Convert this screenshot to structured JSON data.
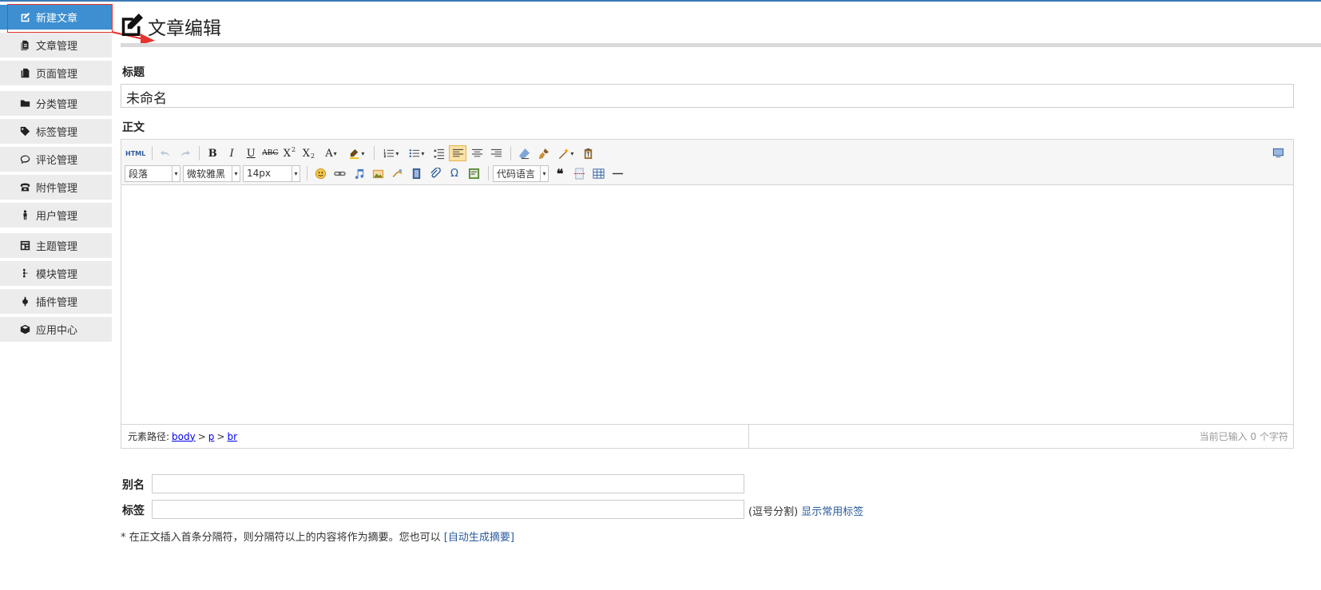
{
  "sidebar": {
    "items": [
      {
        "label": "新建文章",
        "icon": "edit-icon"
      },
      {
        "label": "文章管理",
        "icon": "document-icon"
      },
      {
        "label": "页面管理",
        "icon": "pages-icon"
      },
      {
        "label": "分类管理",
        "icon": "folder-icon"
      },
      {
        "label": "标签管理",
        "icon": "tag-icon"
      },
      {
        "label": "评论管理",
        "icon": "comment-icon"
      },
      {
        "label": "附件管理",
        "icon": "attachment-icon"
      },
      {
        "label": "用户管理",
        "icon": "user-icon"
      },
      {
        "label": "主题管理",
        "icon": "theme-icon"
      },
      {
        "label": "模块管理",
        "icon": "module-icon"
      },
      {
        "label": "插件管理",
        "icon": "plugin-icon"
      },
      {
        "label": "应用中心",
        "icon": "app-center-icon"
      }
    ],
    "active_color": "#3d8fd1"
  },
  "page": {
    "title": "文章编辑"
  },
  "form": {
    "title_label": "标题",
    "title_value": "未命名",
    "body_label": "正文",
    "alias_label": "别名",
    "tags_label": "标签",
    "tags_hint": "(逗号分割)",
    "tags_link": "显示常用标签",
    "summary_hint": "* 在正文插入首条分隔符，则分隔符以上的内容将作为摘要。您也可以",
    "summary_link": "[自动生成摘要]"
  },
  "editor": {
    "html_btn": "HTML",
    "paragraph_select": "段落",
    "font_select": "微软雅黑",
    "size_select": "14px",
    "code_select": "代码语言",
    "path_label": "元素路径:",
    "path": [
      "body",
      "p",
      "br"
    ],
    "path_sep": ">",
    "char_count": "当前已输入 0 个字符"
  }
}
